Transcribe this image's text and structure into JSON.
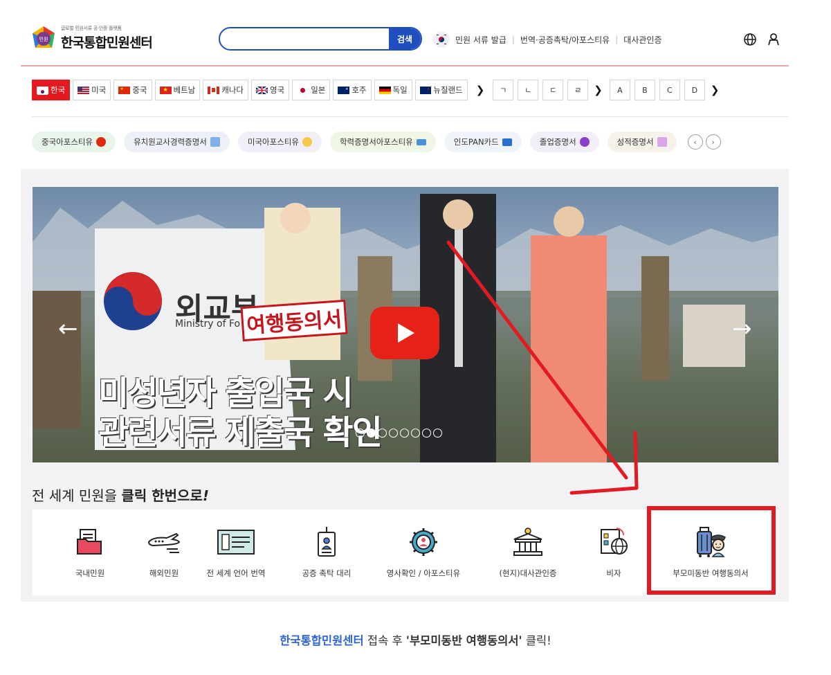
{
  "header": {
    "logo_sub": "글로벌 민원서류 공·인증 플랫폼",
    "logo_title": "한국통합민원센터",
    "logo_badge": "민원",
    "search_placeholder": "",
    "search_button": "검색",
    "links": [
      "민원 서류 발급",
      "번역·공증촉탁/아포스티유",
      "대사관인증"
    ]
  },
  "countries": [
    {
      "label": "한국",
      "active": true
    },
    {
      "label": "미국"
    },
    {
      "label": "중국"
    },
    {
      "label": "베트남"
    },
    {
      "label": "캐나다"
    },
    {
      "label": "영국"
    },
    {
      "label": "일본"
    },
    {
      "label": "호주"
    },
    {
      "label": "독일"
    },
    {
      "label": "뉴질랜드"
    }
  ],
  "korean_letters": [
    "ㄱ",
    "ㄴ",
    "ㄷ",
    "ㄹ"
  ],
  "latin_letters": [
    "A",
    "B",
    "C",
    "D"
  ],
  "doc_tags": [
    {
      "label": "중국아포스티유",
      "bg": "#e9f4ea"
    },
    {
      "label": "유치원교사경력증명서",
      "bg": "#eef0f7"
    },
    {
      "label": "미국아포스티유",
      "bg": "#f1eef8"
    },
    {
      "label": "학력증명서아포스티유",
      "bg": "#eef6e6"
    },
    {
      "label": "인도PAN카드",
      "bg": "#eef4fa"
    },
    {
      "label": "졸업증명서",
      "bg": "#f3eff8"
    },
    {
      "label": "성적증명서",
      "bg": "#f7f1ec"
    }
  ],
  "banner": {
    "ministry_kr": "외교부",
    "ministry_en": "Ministry of Fo",
    "stamp": "여행동의서",
    "headline1": "미성년자 출입국 시",
    "headline2": "관련서류 제출국 확인"
  },
  "slogan": {
    "pre": "전 세계 민원을 ",
    "bold": "클릭 한번으로",
    "post": "!"
  },
  "services": [
    {
      "label": "국내민원",
      "icon": "folder-document-icon"
    },
    {
      "label": "해외민원",
      "icon": "airplane-icon"
    },
    {
      "label": "전 세계 언어 번역",
      "icon": "translation-document-icon"
    },
    {
      "label": "공증 촉탁 대리",
      "icon": "notary-badge-icon"
    },
    {
      "label": "영사확인 / 아포스티유",
      "icon": "consular-gear-icon"
    },
    {
      "label": "(현지)대사관인증",
      "icon": "embassy-building-icon"
    },
    {
      "label": "비자",
      "icon": "visa-globe-icon"
    },
    {
      "label": "부모미동반 여행동의서",
      "icon": "traveler-luggage-icon"
    }
  ],
  "caption": {
    "site": "한국통합민원센터",
    "mid": " 접속 후 ",
    "target": "'부모미동반 여행동의서'",
    "end": " 클릭!"
  },
  "colors": {
    "brand_blue": "#1f4fbf",
    "accent_red": "#e4181e",
    "highlight_red": "#e21b23"
  }
}
